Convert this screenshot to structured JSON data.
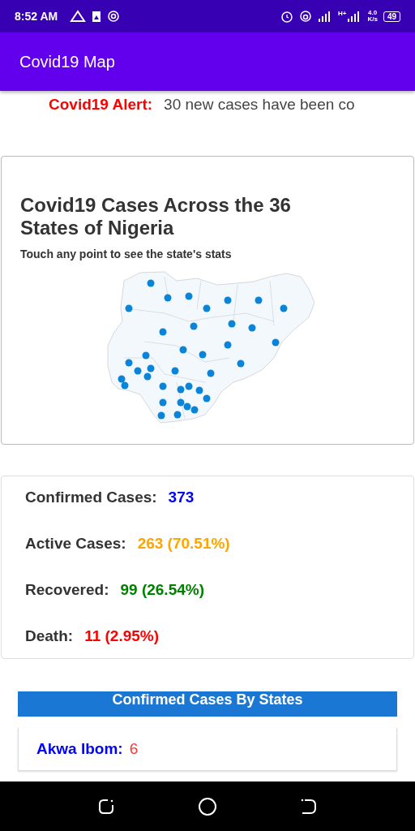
{
  "status_bar": {
    "time": "8:52 AM",
    "speed": "4.0",
    "speed_unit": "K/s",
    "battery": "49",
    "network": "H+"
  },
  "app_bar": {
    "title": "Covid19 Map"
  },
  "alert": {
    "label": "Covid19 Alert:",
    "text": "30 new cases have been co"
  },
  "map_card": {
    "title": "Covid19 Cases Across the 36 States of Nigeria",
    "subtitle": "Touch any point to see the state's stats"
  },
  "stats": [
    {
      "label": "Confirmed Cases:",
      "value": "373",
      "color": "#0000ff"
    },
    {
      "label": "Active Cases:",
      "value": "263 (70.51%)",
      "color": "#ffa500"
    },
    {
      "label": "Recovered:",
      "value": "99 (26.54%)",
      "color": "#008000"
    },
    {
      "label": "Death:",
      "value": "11 (2.95%)",
      "color": "#ff0000"
    }
  ],
  "states_list": {
    "title": "Confirmed Cases By States",
    "items": [
      {
        "name": "Akwa Ibom:",
        "count": "6"
      }
    ]
  }
}
